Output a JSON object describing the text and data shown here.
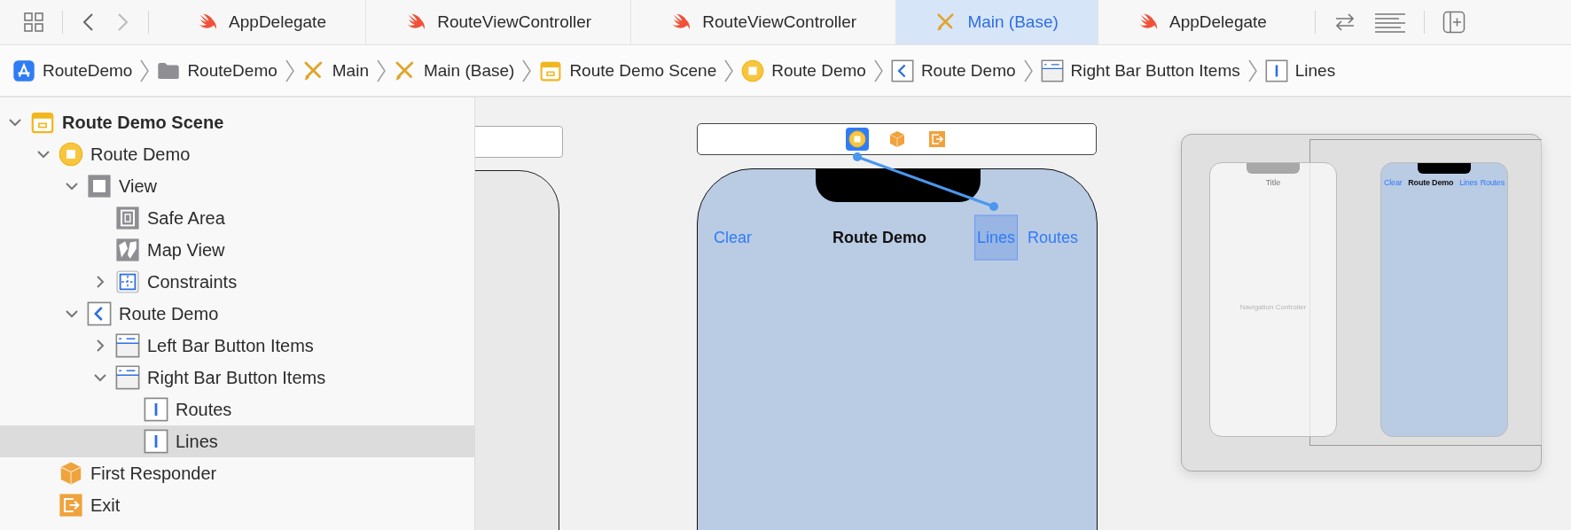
{
  "tabs": [
    {
      "label": "AppDelegate",
      "kind": "swift",
      "selected": false
    },
    {
      "label": "RouteViewController",
      "kind": "swift",
      "selected": false
    },
    {
      "label": "RouteViewController",
      "kind": "swift",
      "selected": false
    },
    {
      "label": "Main (Base)",
      "kind": "storyboard",
      "selected": true
    },
    {
      "label": "AppDelegate",
      "kind": "swift",
      "selected": false
    }
  ],
  "breadcrumbs": [
    {
      "label": "RouteDemo",
      "kind": "app"
    },
    {
      "label": "RouteDemo",
      "kind": "folder"
    },
    {
      "label": "Main",
      "kind": "storyboard"
    },
    {
      "label": "Main (Base)",
      "kind": "storyboard"
    },
    {
      "label": "Route Demo Scene",
      "kind": "scene"
    },
    {
      "label": "Route Demo",
      "kind": "vc"
    },
    {
      "label": "Route Demo",
      "kind": "navitem"
    },
    {
      "label": "Right Bar Button Items",
      "kind": "baritems"
    },
    {
      "label": "Lines",
      "kind": "baritem"
    }
  ],
  "outline": [
    {
      "label": "Route Demo Scene",
      "kind": "scene",
      "expanded": true,
      "selected": false,
      "children": [
        {
          "label": "Route Demo",
          "kind": "vc",
          "expanded": true,
          "selected": false,
          "children": [
            {
              "label": "View",
              "kind": "view",
              "expanded": true,
              "selected": false,
              "children": [
                {
                  "label": "Safe Area",
                  "kind": "safearea",
                  "selected": false
                },
                {
                  "label": "Map View",
                  "kind": "mapview",
                  "selected": false
                },
                {
                  "label": "Constraints",
                  "kind": "constraints",
                  "expanded": false,
                  "selected": false
                }
              ]
            },
            {
              "label": "Route Demo",
              "kind": "navitem",
              "expanded": true,
              "selected": false,
              "children": [
                {
                  "label": "Left Bar Button Items",
                  "kind": "baritems",
                  "expanded": false,
                  "selected": false
                },
                {
                  "label": "Right Bar Button Items",
                  "kind": "baritems",
                  "expanded": true,
                  "selected": false,
                  "children": [
                    {
                      "label": "Routes",
                      "kind": "baritem",
                      "selected": false
                    },
                    {
                      "label": "Lines",
                      "kind": "baritem",
                      "selected": true
                    }
                  ]
                }
              ]
            }
          ]
        },
        {
          "label": "First Responder",
          "kind": "responder",
          "selected": false
        },
        {
          "label": "Exit",
          "kind": "exit",
          "selected": false
        }
      ]
    }
  ],
  "canvas": {
    "scene_dock": [
      {
        "kind": "vc",
        "selected": true
      },
      {
        "kind": "responder",
        "selected": false
      },
      {
        "kind": "exit",
        "selected": false
      }
    ],
    "nav_bar": {
      "left_item": "Clear",
      "title": "Route Demo",
      "right_items": [
        {
          "label": "Lines",
          "selected": true
        },
        {
          "label": "Routes",
          "selected": false
        }
      ]
    }
  },
  "minimap": {
    "nav_controller_title": "Title",
    "nav_controller_label": "Navigation Controller",
    "scene_nav": {
      "left_item": "Clear",
      "title": "Route Demo",
      "right_items": [
        "Lines",
        "Routes"
      ]
    }
  }
}
